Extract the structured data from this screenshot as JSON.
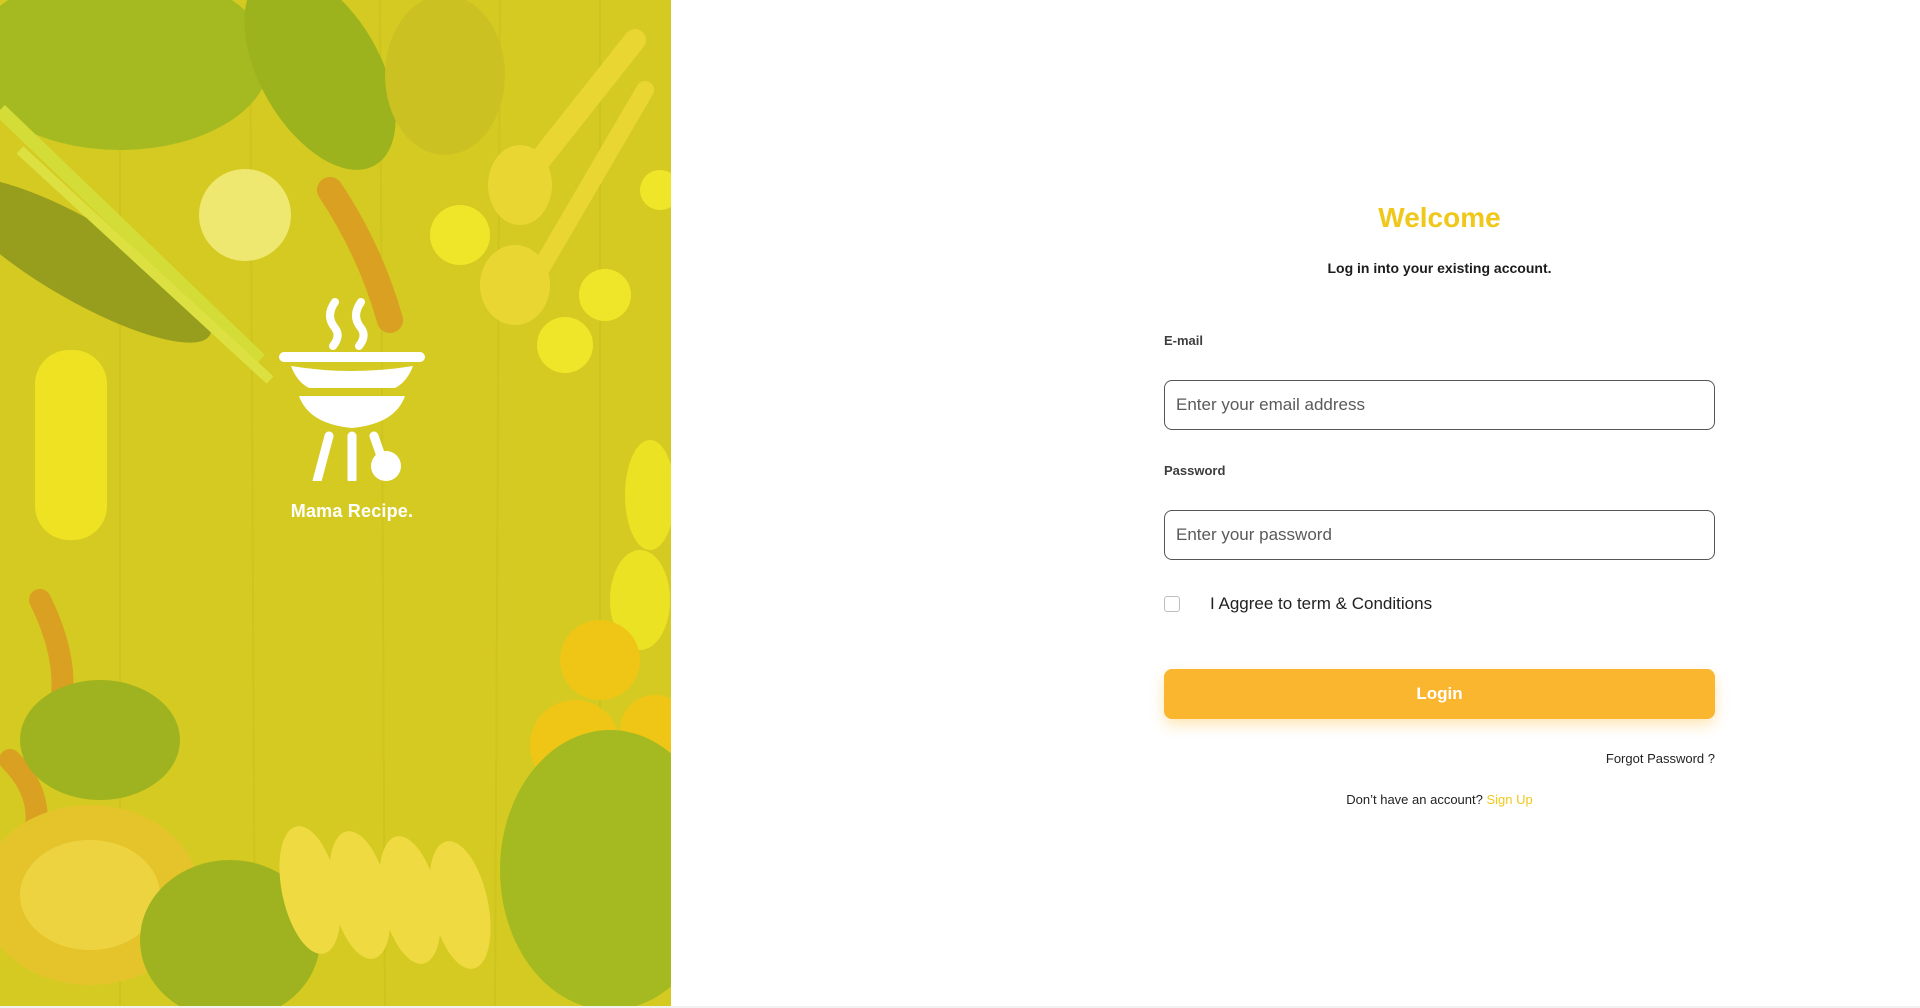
{
  "brand": {
    "name": "Mama Recipe.",
    "logo_icon": "grill-icon"
  },
  "form": {
    "title": "Welcome",
    "subtitle": "Log in into your existing account.",
    "email_label": "E-mail",
    "email_placeholder": "Enter your email address",
    "email_value": "",
    "password_label": "Password",
    "password_placeholder": "Enter your password",
    "password_value": "",
    "agree_label": "I Aggree to term & Conditions",
    "agree_checked": false,
    "login_label": "Login",
    "forgot_label": "Forgot Password ?",
    "no_account_text": "Don’t have an account?",
    "signup_label": "Sign Up"
  },
  "colors": {
    "accent": "#efc81a",
    "button": "#fbb630",
    "hero_overlay": "#ece228"
  }
}
